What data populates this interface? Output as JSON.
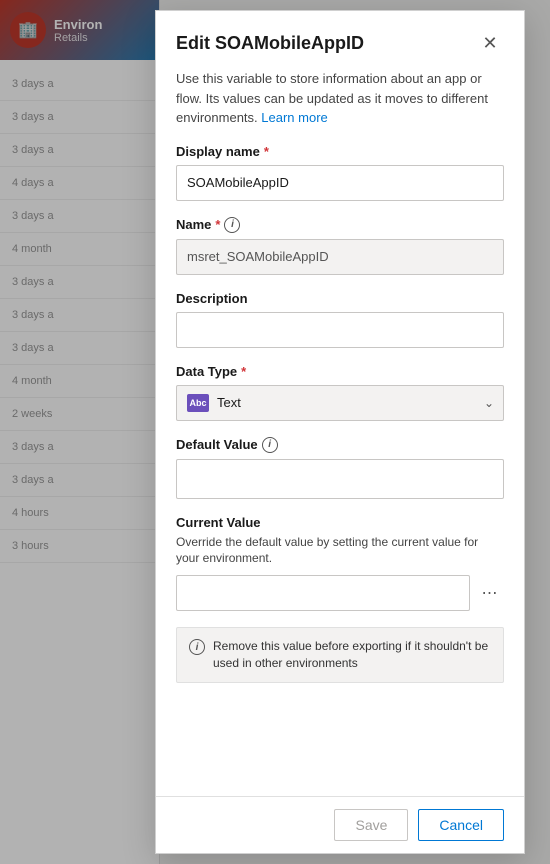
{
  "background": {
    "header": {
      "title": "Environ",
      "subtitle": "Retails"
    },
    "list_items": [
      {
        "time": "3 days a"
      },
      {
        "time": "3 days a"
      },
      {
        "time": "3 days a"
      },
      {
        "time": "4 days a"
      },
      {
        "time": "3 days a"
      },
      {
        "time": "4 month"
      },
      {
        "time": "3 days a"
      },
      {
        "time": "3 days a"
      },
      {
        "time": "3 days a"
      },
      {
        "time": "4 month"
      },
      {
        "time": "2 weeks"
      },
      {
        "time": "3 days a"
      },
      {
        "time": "3 days a"
      },
      {
        "time": "4 hours"
      },
      {
        "time": "3 hours"
      }
    ]
  },
  "dialog": {
    "title": "Edit SOAMobileAppID",
    "description": "Use this variable to store information about an app or flow. Its values can be updated as it moves to different environments.",
    "learn_more_label": "Learn more",
    "display_name": {
      "label": "Display name",
      "required": true,
      "value": "SOAMobileAppID"
    },
    "name": {
      "label": "Name",
      "required": true,
      "value": "msret_SOAMobileAppID",
      "readonly": true
    },
    "description_field": {
      "label": "Description",
      "value": "",
      "placeholder": ""
    },
    "data_type": {
      "label": "Data Type",
      "required": true,
      "icon_label": "Abc",
      "value": "Text"
    },
    "default_value": {
      "label": "Default Value",
      "value": "",
      "placeholder": ""
    },
    "current_value": {
      "label": "Current Value",
      "description": "Override the default value by setting the current value for your environment.",
      "value": "",
      "placeholder": ""
    },
    "info_banner": {
      "text": "Remove this value before exporting if it shouldn't be used in other environments"
    },
    "footer": {
      "save_label": "Save",
      "cancel_label": "Cancel"
    }
  }
}
